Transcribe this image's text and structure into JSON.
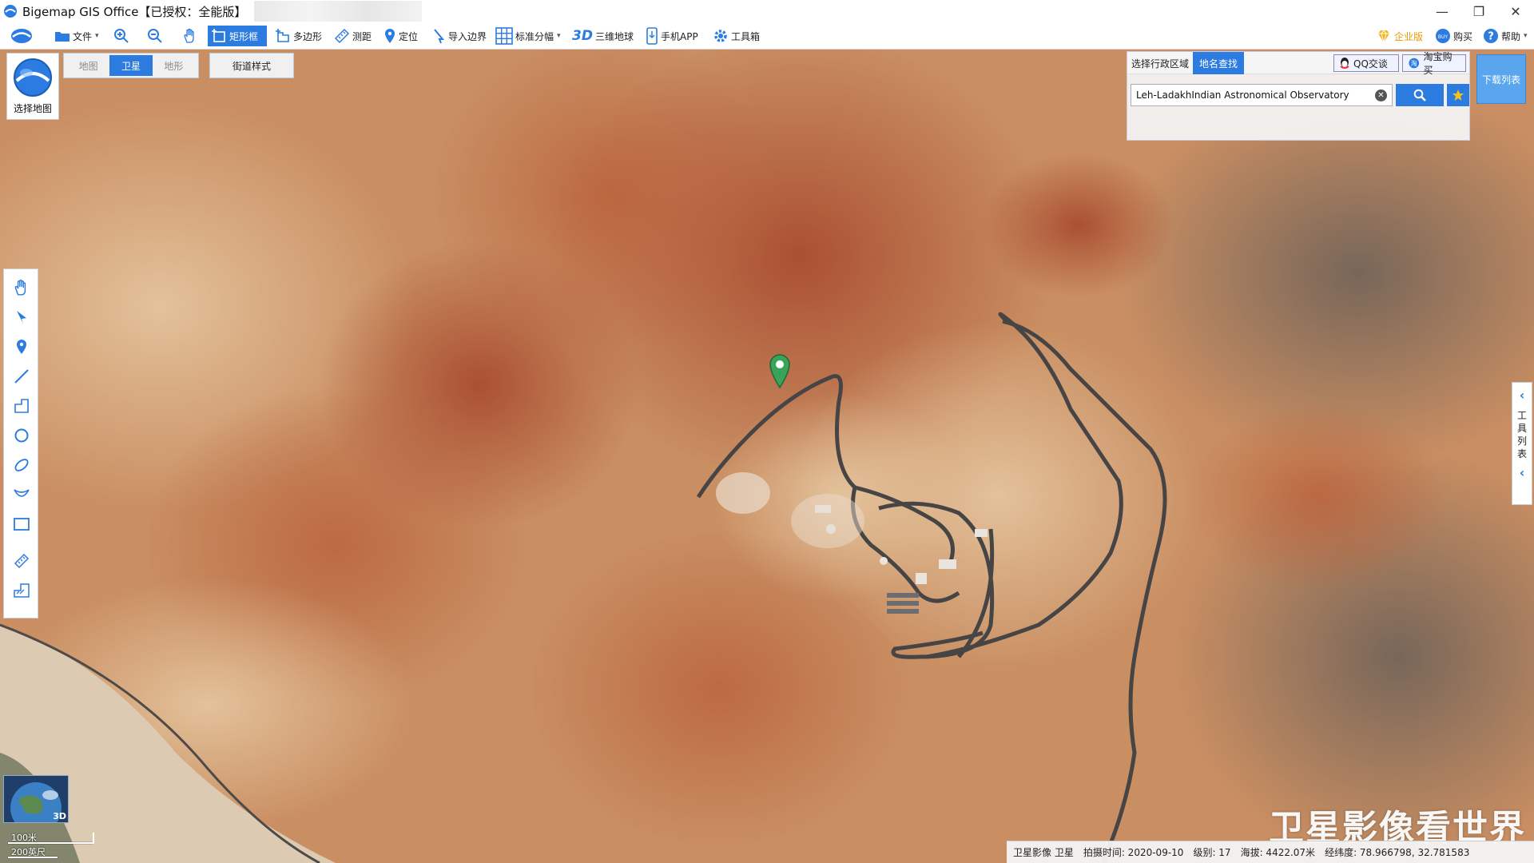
{
  "window": {
    "title": "Bigemap GIS Office【已授权：全能版】"
  },
  "toolbar": {
    "file": "文件",
    "rectangle": "矩形框",
    "polygon": "多边形",
    "measure": "测距",
    "locate": "定位",
    "import_border": "导入边界",
    "standard_sheet": "标准分幅",
    "globe_3d_prefix": "3D",
    "globe_3d": "三维地球",
    "mobile_app": "手机APP",
    "toolbox": "工具箱",
    "enterprise": "企业版",
    "buy": "购买",
    "help": "帮助"
  },
  "map_chooser": {
    "label": "选择地图"
  },
  "map_type": {
    "options": [
      "地图",
      "卫星",
      "地形"
    ],
    "selected": "卫星",
    "street_style": "街道样式"
  },
  "search": {
    "tab_region": "选择行政区域",
    "tab_place": "地名查找",
    "qq": "QQ交谈",
    "taobao": "淘宝购买",
    "query": "Leh-LadakhIndian Astronomical Observatory"
  },
  "download_list": "下载列表",
  "tool_list": "工具列表",
  "mini_map": {
    "badge": "3D"
  },
  "scale": {
    "metric": "100米",
    "imperial": "200英尺"
  },
  "watermark": "卫星影像看世界",
  "status": {
    "source": "卫星影像 卫星",
    "capture_time": "拍摄时间: 2020-09-10",
    "level": "级别:  17",
    "elevation": "海拔: 4422.07米",
    "lonlat": "经纬度:   78.966798, 32.781583"
  },
  "colors": {
    "accent": "#2b7be0",
    "terrain_base": "#c98a5a",
    "marker": "#3aa35a"
  }
}
